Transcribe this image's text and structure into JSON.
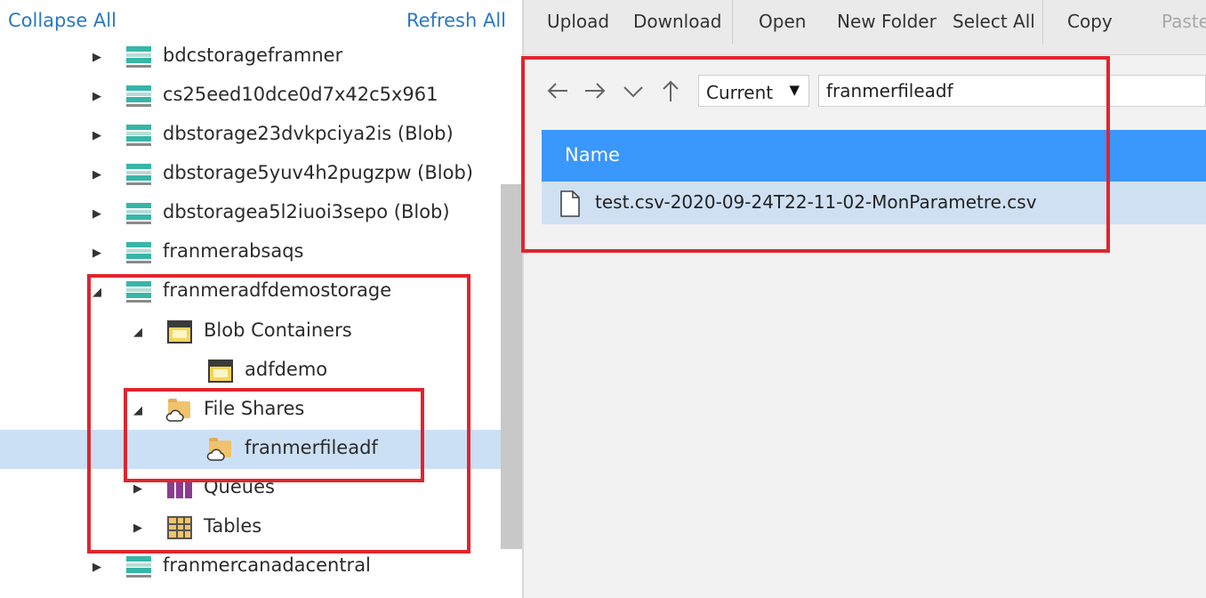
{
  "explorer": {
    "collapse_all": "Collapse All",
    "refresh_all": "Refresh All",
    "tree": [
      {
        "label": "bdcstorageframner",
        "icon": "storage-account-icon",
        "expanded": false
      },
      {
        "label": "cs25eed10dce0d7x42c5x961",
        "icon": "storage-account-icon",
        "expanded": false
      },
      {
        "label": "dbstorage23dvkpciya2is (Blob)",
        "icon": "storage-account-icon",
        "expanded": false
      },
      {
        "label": "dbstorage5yuv4h2pugzpw (Blob)",
        "icon": "storage-account-icon",
        "expanded": false
      },
      {
        "label": "dbstoragea5l2iuoi3sepo (Blob)",
        "icon": "storage-account-icon",
        "expanded": false
      },
      {
        "label": "franmerabsaqs",
        "icon": "storage-account-icon",
        "expanded": false
      },
      {
        "label": "franmeradfdemostorage",
        "icon": "storage-account-icon",
        "expanded": true
      },
      {
        "label": "Blob Containers",
        "icon": "blob-container-icon",
        "expanded": true
      },
      {
        "label": "adfdemo",
        "icon": "blob-container-icon"
      },
      {
        "label": "File Shares",
        "icon": "file-share-icon",
        "expanded": true
      },
      {
        "label": "franmerfileadf",
        "icon": "file-share-icon",
        "selected": true
      },
      {
        "label": "Queues",
        "icon": "queue-icon",
        "expanded": false
      },
      {
        "label": "Tables",
        "icon": "table-icon",
        "expanded": false
      },
      {
        "label": "franmercanadacentral",
        "icon": "storage-account-icon",
        "expanded": false
      }
    ]
  },
  "toolbar": {
    "upload": "Upload",
    "download": "Download",
    "open": "Open",
    "new_folder": "New Folder",
    "select_all": "Select All",
    "copy": "Copy",
    "paste": "Paste"
  },
  "navigation": {
    "view_select": "Current",
    "path": "franmerfileadf"
  },
  "file_list": {
    "column_name": "Name",
    "files": [
      {
        "name": "test.csv-2020-09-24T22-11-02-MonParametre.csv",
        "icon": "file-icon",
        "selected": true
      }
    ]
  },
  "colors": {
    "accent_link": "#2a79c4",
    "grid_header": "#3a97fb",
    "selection": "#cce0f5",
    "highlight_box": "#e0252e"
  }
}
